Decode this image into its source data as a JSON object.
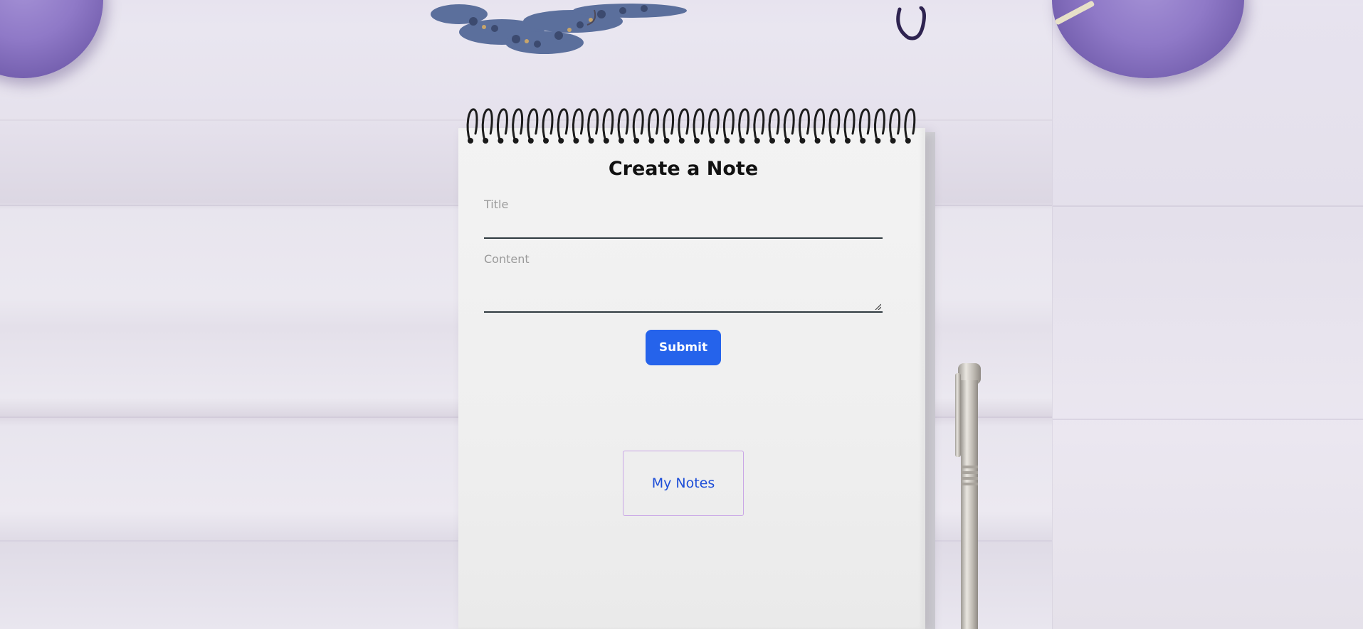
{
  "form": {
    "heading": "Create a Note",
    "title_placeholder": "Title",
    "content_placeholder": "Content",
    "submit_label": "Submit"
  },
  "nav": {
    "my_notes_label": "My Notes"
  },
  "colors": {
    "accent": "#2563eb",
    "link": "#1d4ed8",
    "link_border": "#c9a6e6"
  },
  "decor": {
    "icons": [
      "lavender-sprig-icon",
      "thread-spool-icon",
      "pen-icon",
      "spiral-binding-icon"
    ]
  }
}
